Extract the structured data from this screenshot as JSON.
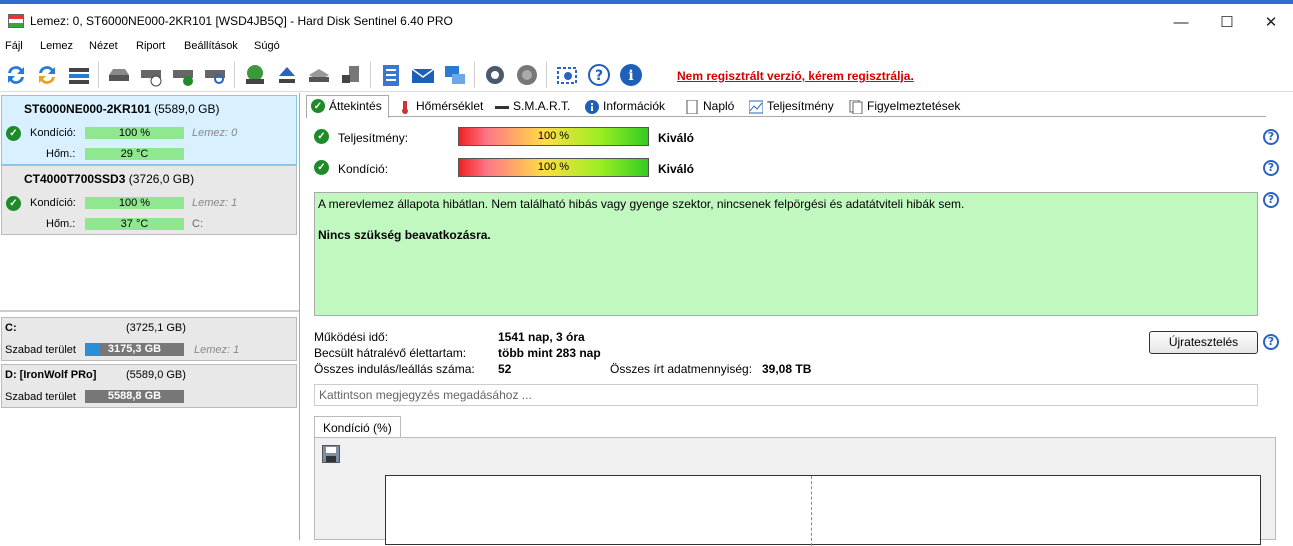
{
  "window": {
    "title": "Lemez: 0, ST6000NE000-2KR101 [WSD4JB5Q] - Hard Disk Sentinel 6.40 PRO"
  },
  "menu": [
    "Fájl",
    "Lemez",
    "Nézet",
    "Riport",
    "Beállítások",
    "Súgó"
  ],
  "unregistered": "Nem regisztrált verzió, kérem regisztrálja.",
  "disks": [
    {
      "name": "ST6000NE000-2KR101",
      "size": "(5589,0 GB)",
      "cond_label": "Kondíció:",
      "cond_value": "100 %",
      "cond_note": "Lemez: 0",
      "temp_label": "Hőm.:",
      "temp_value": "29 °C",
      "temp_note": ""
    },
    {
      "name": "CT4000T700SSD3",
      "size": "(3726,0 GB)",
      "cond_label": "Kondíció:",
      "cond_value": "100 %",
      "cond_note": "Lemez: 1",
      "temp_label": "Hőm.:",
      "temp_value": "37 °C",
      "temp_note": "C:"
    }
  ],
  "volumes": [
    {
      "name": "C:",
      "size": "(3725,1 GB)",
      "free_label": "Szabad terület",
      "free_value": "3175,3 GB",
      "note": "Lemez: 1",
      "fill": 0.15
    },
    {
      "name": "D: [IronWolf PRo]",
      "size": "(5589,0 GB)",
      "free_label": "Szabad terület",
      "free_value": "5588,8 GB",
      "note": "",
      "fill": 0.0
    }
  ],
  "tabs": [
    "Áttekintés",
    "Hőmérséklet",
    "S.M.A.R.T.",
    "Információk",
    "Napló",
    "Teljesítmény",
    "Figyelmeztetések"
  ],
  "overview": {
    "perf_label": "Teljesítmény:",
    "perf_value": "100 %",
    "perf_text": "Kiváló",
    "cond_label": "Kondíció:",
    "cond_value": "100 %",
    "cond_text": "Kiváló",
    "status_line1": "A merevlemez állapota hibátlan. Nem található hibás vagy gyenge szektor, nincsenek felpörgési és adatátviteli hibák sem.",
    "status_line2": "Nincs szükség beavatkozásra.",
    "uptime_label": "Működési idő:",
    "uptime_value": "1541 nap, 3 óra",
    "life_label": "Becsült hátralévő élettartam:",
    "life_value": "több mint 283 nap",
    "starts_label": "Összes indulás/leállás száma:",
    "starts_value": "52",
    "written_label": "Összes írt adatmennyiség:",
    "written_value": "39,08 TB",
    "retest": "Újratesztelés",
    "comment_placeholder": "Kattintson megjegyzés megadásához ...",
    "graph_tab": "Kondíció  (%)"
  }
}
